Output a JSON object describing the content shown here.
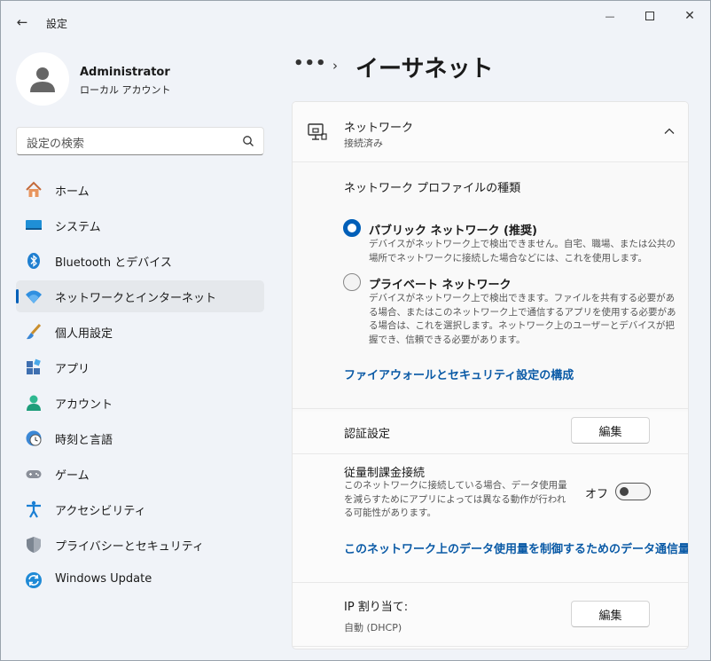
{
  "window": {
    "title": "設定",
    "back_icon": "←",
    "minimize_icon": "—",
    "close_icon": "✕"
  },
  "profile": {
    "name": "Administrator",
    "type": "ローカル アカウント"
  },
  "search": {
    "placeholder": "設定の検索"
  },
  "sidebar": {
    "items": [
      {
        "label": "ホーム",
        "icon": "home-icon"
      },
      {
        "label": "システム",
        "icon": "system-icon"
      },
      {
        "label": "Bluetooth とデバイス",
        "icon": "bluetooth-icon"
      },
      {
        "label": "ネットワークとインターネット",
        "icon": "wifi-icon",
        "selected": true
      },
      {
        "label": "個人用設定",
        "icon": "brush-icon"
      },
      {
        "label": "アプリ",
        "icon": "apps-icon"
      },
      {
        "label": "アカウント",
        "icon": "account-icon"
      },
      {
        "label": "時刻と言語",
        "icon": "clock-globe-icon"
      },
      {
        "label": "ゲーム",
        "icon": "gamepad-icon"
      },
      {
        "label": "アクセシビリティ",
        "icon": "accessibility-icon"
      },
      {
        "label": "プライバシーとセキュリティ",
        "icon": "shield-icon"
      },
      {
        "label": "Windows Update",
        "icon": "update-icon"
      }
    ]
  },
  "breadcrumb": {
    "more": "•••",
    "separator": "›",
    "title": "イーサネット"
  },
  "network": {
    "title": "ネットワーク",
    "status": "接続済み",
    "profile_heading": "ネットワーク プロファイルの種類",
    "public": {
      "title": "パブリック ネットワーク (推奨)",
      "desc": "デバイスがネットワーク上で検出できません。自宅、職場、または公共の場所でネットワークに接続した場合などには、これを使用します。",
      "selected": true
    },
    "private": {
      "title": "プライベート ネットワーク",
      "desc": "デバイスがネットワーク上で検出できます。ファイルを共有する必要がある場合、またはこのネットワーク上で通信するアプリを使用する必要がある場合は、これを選択します。ネットワーク上のユーザーとデバイスが把握でき、信頼できる必要があります。",
      "selected": false
    },
    "firewall_link": "ファイアウォールとセキュリティ設定の構成"
  },
  "auth": {
    "label": "認証設定",
    "edit": "編集"
  },
  "metered": {
    "label": "従量制課金接続",
    "desc": "このネットワークに接続している場合、データ使用量を減らすためにアプリによっては異なる動作が行われる可能性があります。",
    "state": "オフ",
    "on": false,
    "data_limit_link": "このネットワーク上のデータ使用量を制御するためのデータ通信量"
  },
  "ip": {
    "label": "IP 割り当て:",
    "value": "自動 (DHCP)",
    "edit": "編集"
  },
  "colors": {
    "accent": "#005fb8",
    "link": "#0a5aa6"
  }
}
